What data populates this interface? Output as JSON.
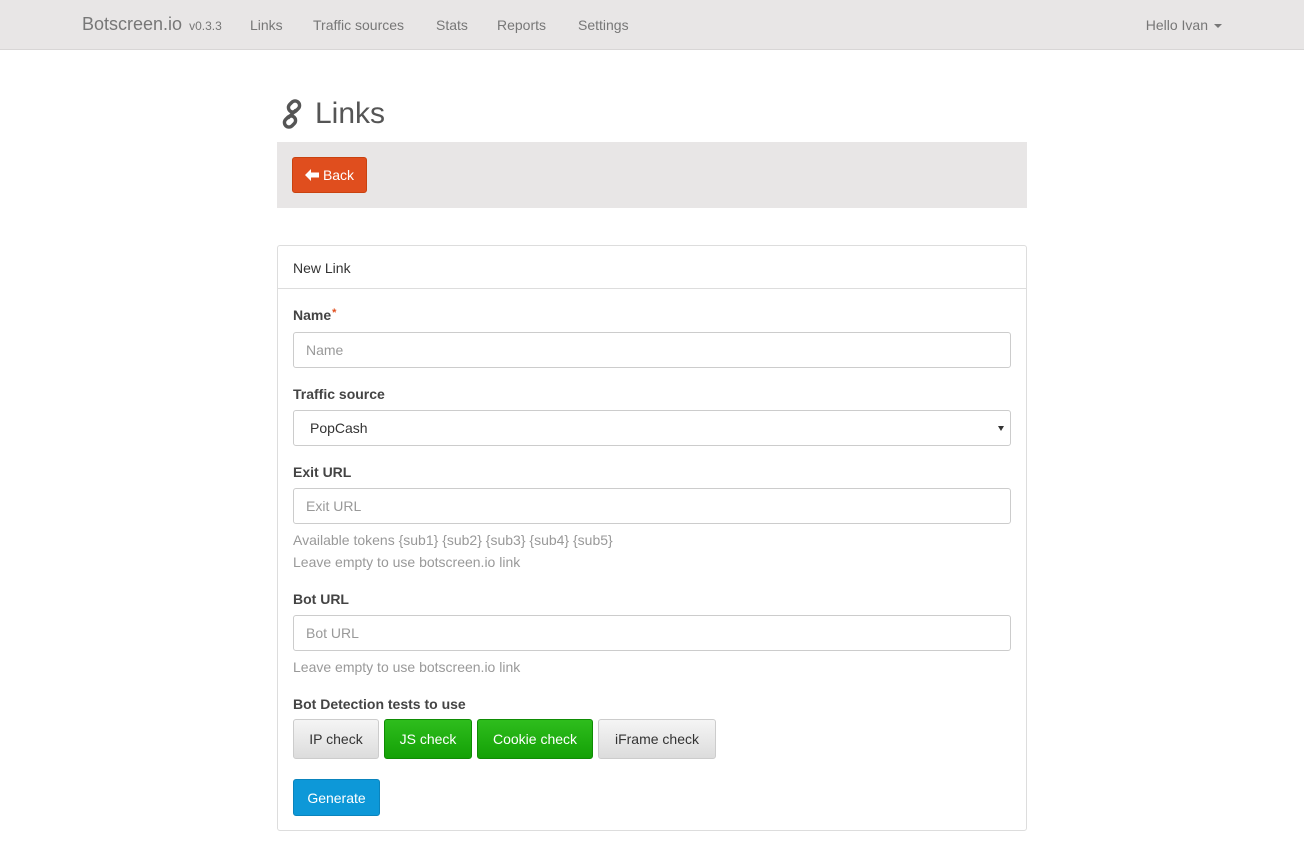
{
  "navbar": {
    "brand": "Botscreen.io",
    "version": "v0.3.3",
    "links": [
      "Links",
      "Traffic sources",
      "Stats",
      "Reports",
      "Settings"
    ],
    "user": "Hello Ivan"
  },
  "page": {
    "title": "Links",
    "back_label": "Back"
  },
  "form": {
    "heading": "New Link",
    "name": {
      "label": "Name",
      "required_mark": "*",
      "placeholder": "Name",
      "value": ""
    },
    "traffic_source": {
      "label": "Traffic source",
      "selected": "PopCash"
    },
    "exit_url": {
      "label": "Exit URL",
      "placeholder": "Exit URL",
      "help_tokens": "Available tokens {sub1} {sub2} {sub3} {sub4} {sub5}",
      "help_empty": "Leave empty to use botscreen.io link"
    },
    "bot_url": {
      "label": "Bot URL",
      "placeholder": "Bot URL",
      "help_empty": "Leave empty to use botscreen.io link"
    },
    "tests": {
      "label": "Bot Detection tests to use",
      "items": [
        {
          "label": "IP check",
          "active": false
        },
        {
          "label": "JS check",
          "active": true
        },
        {
          "label": "Cookie check",
          "active": true
        },
        {
          "label": "iFrame check",
          "active": false
        }
      ]
    },
    "generate_label": "Generate"
  },
  "colors": {
    "navbar_bg": "#e8e6e6",
    "back_button": "#e04e1e",
    "test_active": "#14a106",
    "generate_button": "#0d98d8"
  }
}
